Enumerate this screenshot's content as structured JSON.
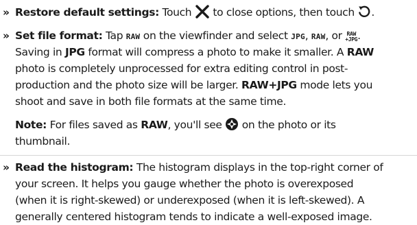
{
  "items": {
    "restore": {
      "bullet": "»",
      "title": "Restore default settings:",
      "t1": " Touch ",
      "t2": " to close options, then touch ",
      "t3": "."
    },
    "format": {
      "bullet": "»",
      "title": "Set file format:",
      "t1": " Tap ",
      "raw_glyph": "RAW",
      "t2": " on the viewfinder and select ",
      "jpg_glyph": "JPG",
      "t3": ", ",
      "t4": ", or ",
      "stack_top": "RAW",
      "stack_bottom": "+JPG",
      "t5": ".",
      "l2a": "Saving in ",
      "l2b": "JPG",
      "l2c": " format will compress a photo to make it smaller. A ",
      "l2d": "RAW",
      "l3": "photo is completely unprocessed for extra editing control in post-",
      "l4a": "production and the photo size will be larger. ",
      "l4b": "RAW+JPG",
      "l4c": " mode lets you",
      "l5": "shoot and save in both file formats at the same time."
    },
    "note": {
      "a": "Note:",
      "b": " For files saved as ",
      "c": "RAW",
      "d": ", you'll see ",
      "e": " on the photo or its",
      "f": "thumbnail."
    },
    "histogram": {
      "bullet": "»",
      "title": "Read the histogram:",
      "l1": " The histogram displays in the top-right corner of",
      "l2": "your screen. It helps you gauge whether the photo is overexposed",
      "l3": "(when it is right-skewed) or underexposed (when it is left-skewed). A",
      "l4": "generally centered histogram tends to indicate a well-exposed image."
    }
  }
}
